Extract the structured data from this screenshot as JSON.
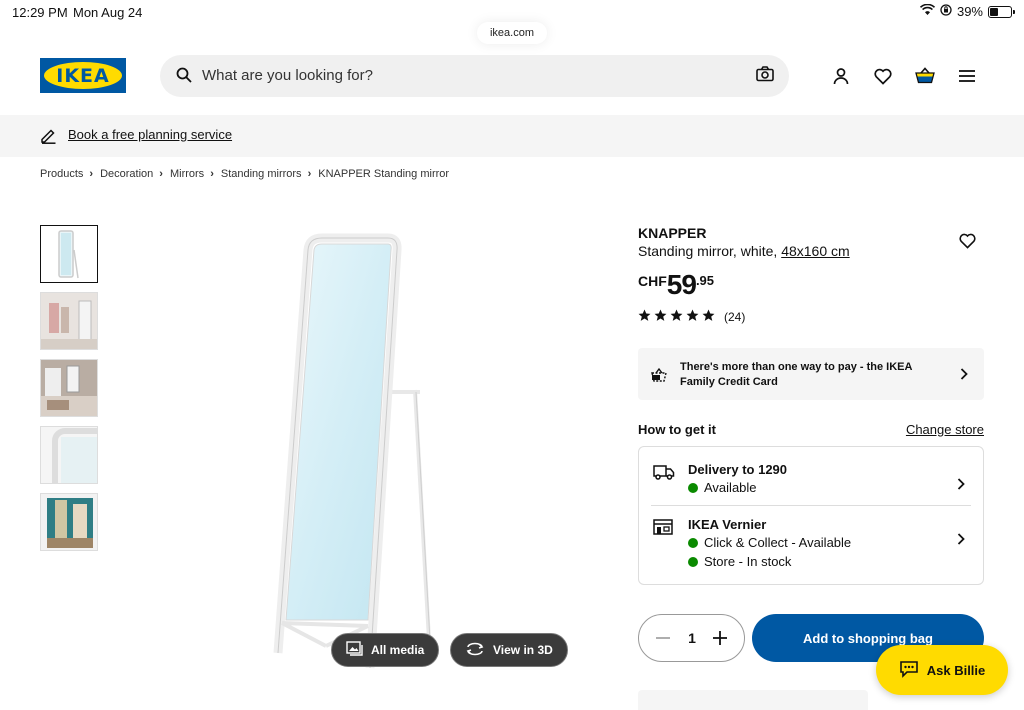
{
  "status_bar": {
    "time": "12:29 PM",
    "date": "Mon Aug 24",
    "battery": "39%"
  },
  "browser": {
    "url": "ikea.com"
  },
  "header": {
    "logo_text": "IKEA",
    "search_placeholder": "What are you looking for?"
  },
  "banner": {
    "link_text": "Book a free planning service"
  },
  "breadcrumb": [
    "Products",
    "Decoration",
    "Mirrors",
    "Standing mirrors",
    "KNAPPER Standing mirror"
  ],
  "product": {
    "name": "KNAPPER",
    "description": "Standing mirror, white,",
    "size": "48x160 cm",
    "currency": "CHF",
    "price_int": "59",
    "price_dec": ".95",
    "rating_stars": 5,
    "review_count": "(24)"
  },
  "media": {
    "all_media": "All media",
    "view_3d": "View in 3D"
  },
  "payment": {
    "text": "There's more than one way to pay - the IKEA Family Credit Card"
  },
  "how_to_get": {
    "heading": "How to get it",
    "change_store": "Change store",
    "delivery": {
      "title": "Delivery to 1290",
      "status": "Available"
    },
    "store": {
      "title": "IKEA Vernier",
      "click_collect": "Click & Collect - Available",
      "in_store": "Store - In stock"
    }
  },
  "cart": {
    "quantity": "1",
    "add_label": "Add to shopping bag"
  },
  "assistant": {
    "label": "Ask Billie"
  },
  "colors": {
    "ikea_blue": "#0058a3",
    "ikea_yellow": "#ffdb00",
    "available_green": "#0a8a00"
  }
}
